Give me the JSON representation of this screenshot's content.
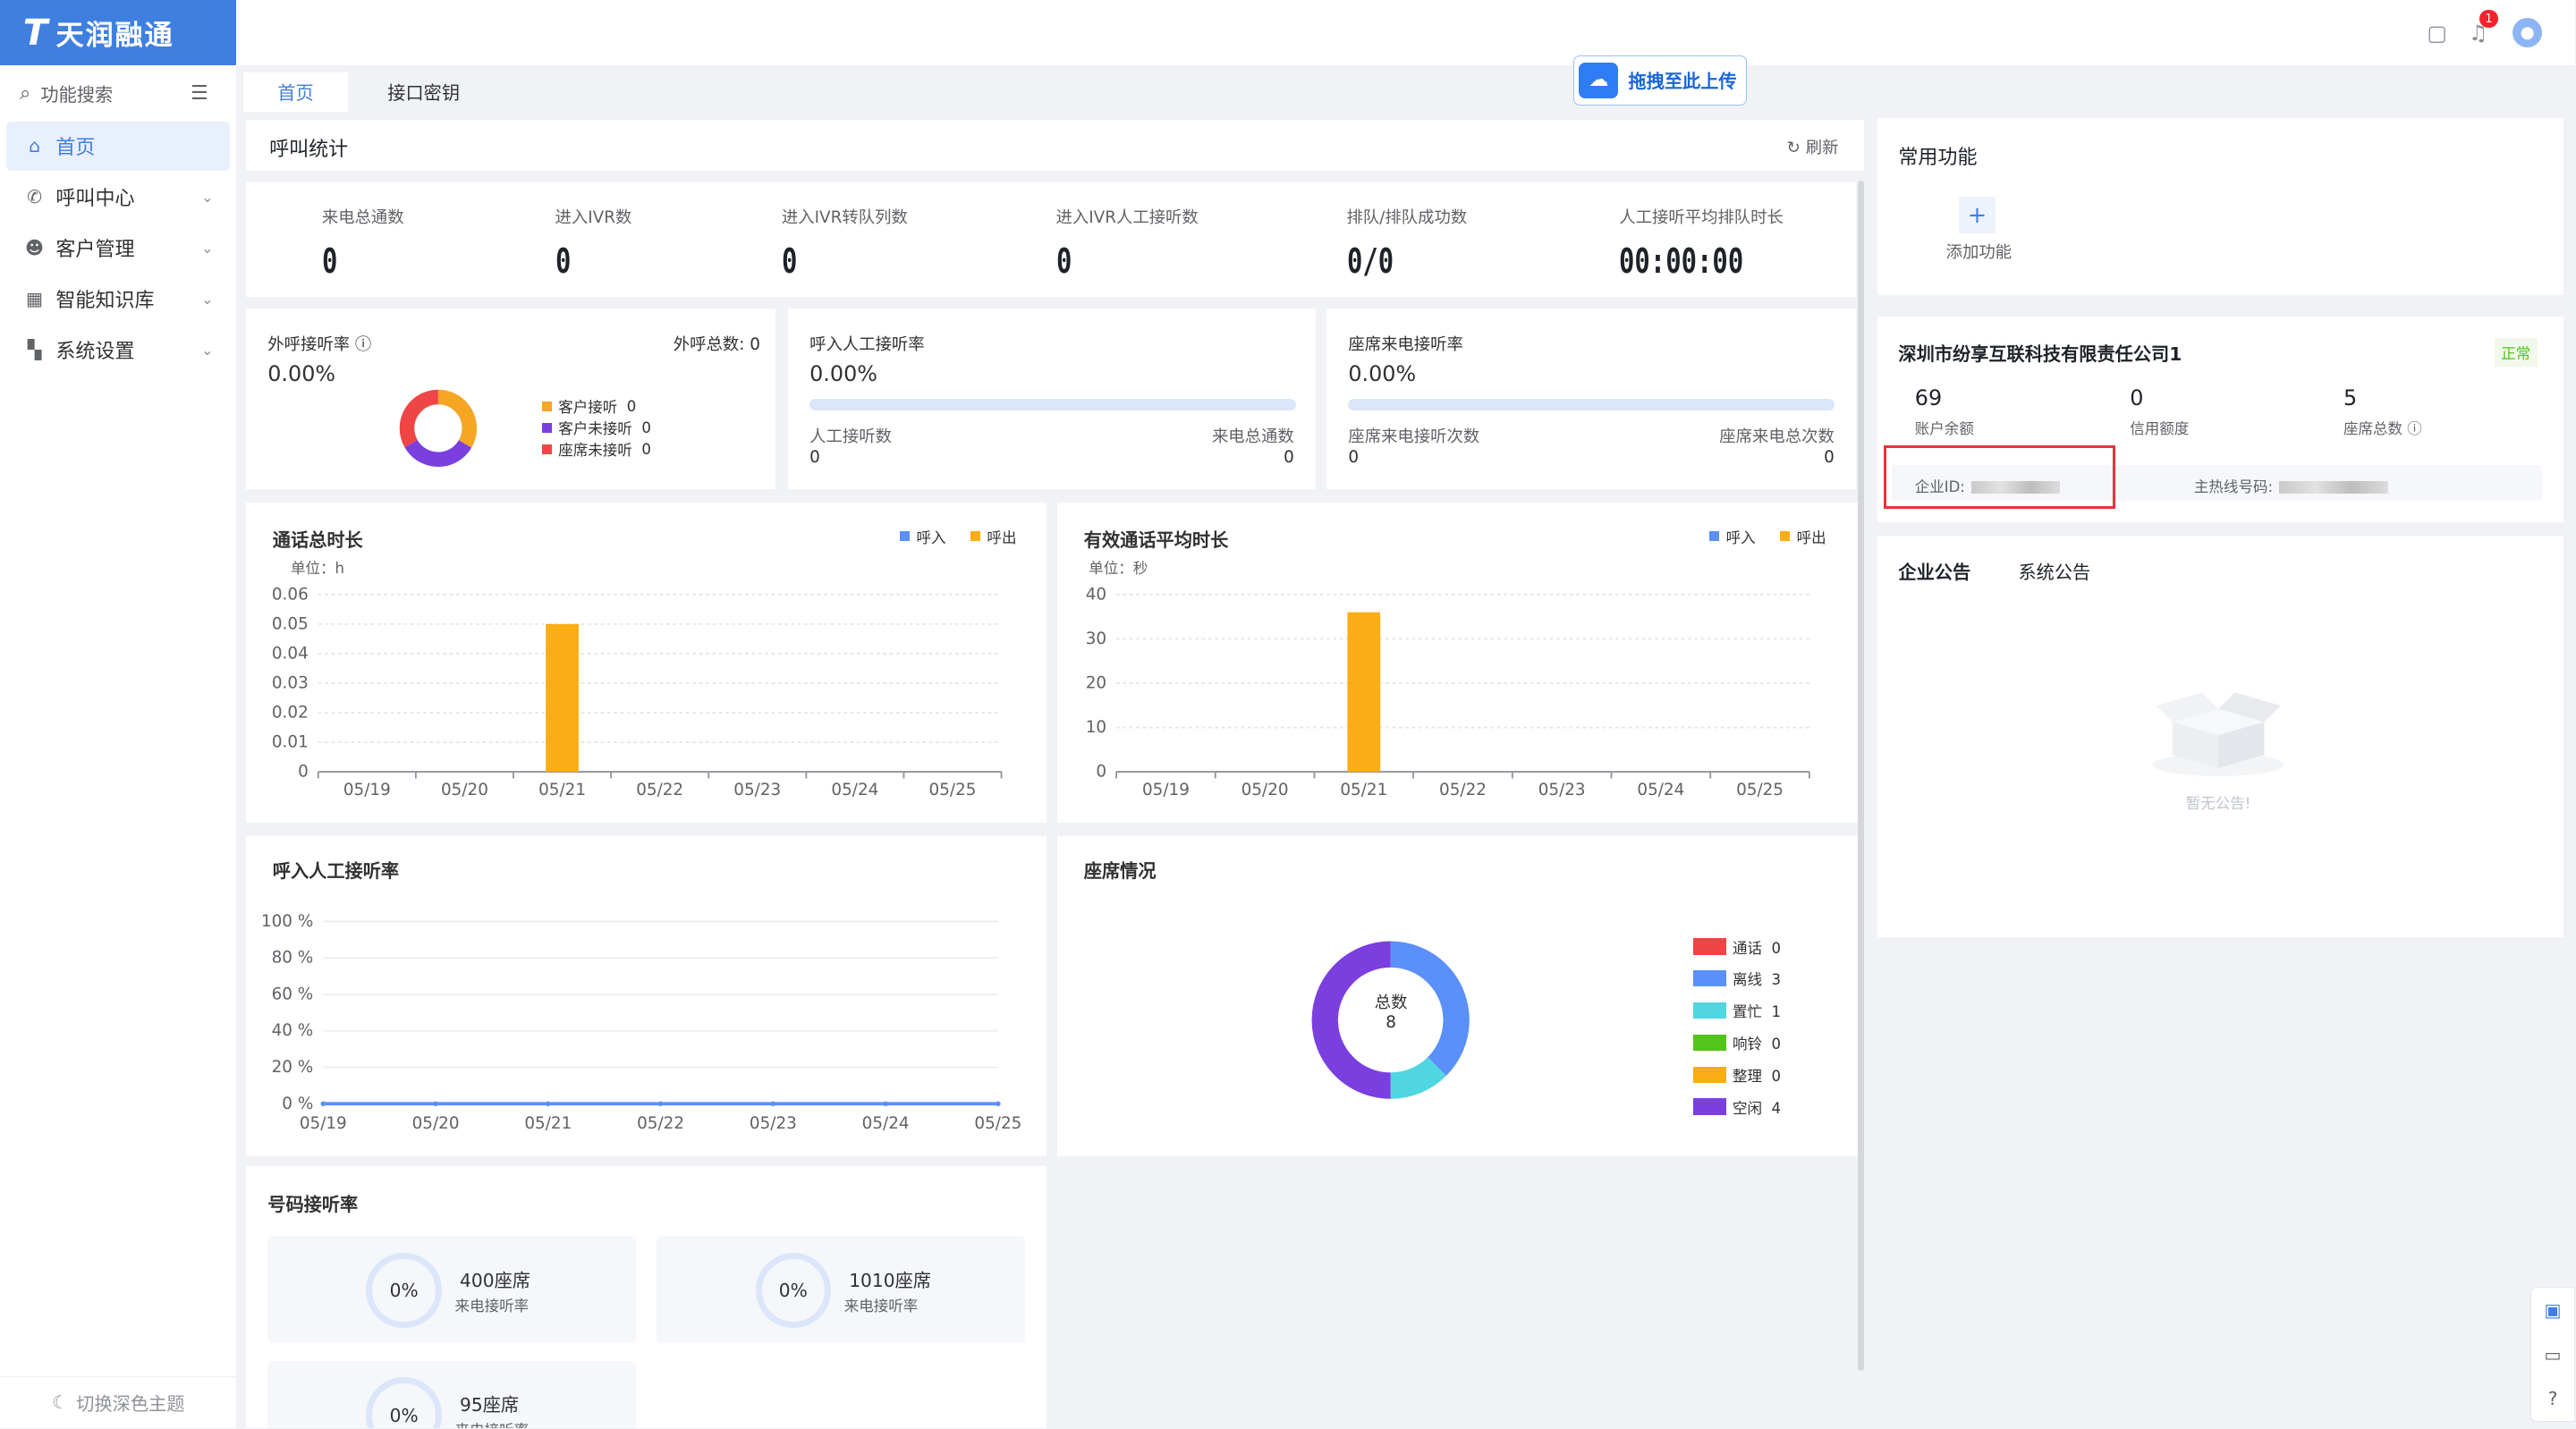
{
  "brand": {
    "logo_text": "天润融通",
    "logo_mark": "T"
  },
  "topbar": {
    "bell_count": "1",
    "calendar_icon": "calendar-icon",
    "bell_icon": "bell-icon",
    "avatar_icon": "user-avatar-icon"
  },
  "sidebar": {
    "search_label": "功能搜索",
    "items": [
      {
        "label": "首页",
        "icon": "home-icon",
        "active": true
      },
      {
        "label": "呼叫中心",
        "icon": "phone-icon"
      },
      {
        "label": "客户管理",
        "icon": "users-icon"
      },
      {
        "label": "智能知识库",
        "icon": "grid-icon"
      },
      {
        "label": "系统设置",
        "icon": "settings-grid-icon"
      }
    ],
    "theme_toggle": "切换深色主题"
  },
  "tabs": [
    {
      "label": "首页",
      "active": true
    },
    {
      "label": "接口密钥"
    }
  ],
  "upload_button": "拖拽至此上传",
  "call_stats": {
    "title": "呼叫统计",
    "refresh": "刷新",
    "items": [
      {
        "label": "来电总通数",
        "value": "0"
      },
      {
        "label": "进入IVR数",
        "value": "0"
      },
      {
        "label": "进入IVR转队列数",
        "value": "0"
      },
      {
        "label": "进入IVR人工接听数",
        "value": "0"
      },
      {
        "label": "排队/排队成功数",
        "value": "0/0"
      },
      {
        "label": "人工接听平均排队时长",
        "value": "00:00:00"
      }
    ]
  },
  "outbound": {
    "label": "外呼接听率",
    "rate": "0.00%",
    "total_label": "外呼总数:",
    "total": "0",
    "legend": [
      {
        "label": "客户接听",
        "value": "0",
        "color": "#f5a623"
      },
      {
        "label": "客户未接听",
        "value": "0",
        "color": "#7b3fe0"
      },
      {
        "label": "座席未接听",
        "value": "0",
        "color": "#f04545"
      }
    ]
  },
  "inbound_rate": {
    "label": "呼入人工接听率",
    "rate": "0.00%",
    "left_label": "人工接听数",
    "left_value": "0",
    "right_label": "来电总通数",
    "right_value": "0"
  },
  "seat_rate": {
    "label": "座席来电接听率",
    "rate": "0.00%",
    "left_label": "座席来电接听次数",
    "left_value": "0",
    "right_label": "座席来电总次数",
    "right_value": "0"
  },
  "chart_data": [
    {
      "type": "bar",
      "title": "通话总时长",
      "unit": "单位：h",
      "categories": [
        "05/19",
        "05/20",
        "05/21",
        "05/22",
        "05/23",
        "05/24",
        "05/25"
      ],
      "yticks": [
        "0",
        "0.01",
        "0.02",
        "0.03",
        "0.04",
        "0.05",
        "0.06"
      ],
      "ylim": [
        0,
        0.06
      ],
      "series": [
        {
          "name": "呼入",
          "color": "#5b8ff9",
          "values": [
            0,
            0,
            0,
            0,
            0,
            0,
            0
          ]
        },
        {
          "name": "呼出",
          "color": "#faad14",
          "values": [
            0,
            0,
            0.05,
            0,
            0,
            0,
            0
          ]
        }
      ]
    },
    {
      "type": "bar",
      "title": "有效通话平均时长",
      "unit": "单位：秒",
      "categories": [
        "05/19",
        "05/20",
        "05/21",
        "05/22",
        "05/23",
        "05/24",
        "05/25"
      ],
      "yticks": [
        "0",
        "10",
        "20",
        "30",
        "40"
      ],
      "ylim": [
        0,
        40
      ],
      "series": [
        {
          "name": "呼入",
          "color": "#5b8ff9",
          "values": [
            0,
            0,
            0,
            0,
            0,
            0,
            0
          ]
        },
        {
          "name": "呼出",
          "color": "#faad14",
          "values": [
            0,
            0,
            36,
            0,
            0,
            0,
            0
          ]
        }
      ]
    },
    {
      "type": "line",
      "title": "呼入人工接听率",
      "categories": [
        "05/19",
        "05/20",
        "05/21",
        "05/22",
        "05/23",
        "05/24",
        "05/25"
      ],
      "yticks": [
        "0 %",
        "20 %",
        "40 %",
        "60 %",
        "80 %",
        "100 %"
      ],
      "ylim": [
        0,
        100
      ],
      "series": [
        {
          "values": [
            0,
            0,
            0,
            0,
            0,
            0,
            0
          ],
          "color": "#5b8ff9"
        }
      ]
    },
    {
      "type": "pie",
      "title": "座席情况",
      "center_label": "总数",
      "total": "8",
      "slices": [
        {
          "label": "通话",
          "value": 0,
          "color": "#f04545"
        },
        {
          "label": "离线",
          "value": 3,
          "color": "#5b8ff9"
        },
        {
          "label": "置忙",
          "value": 1,
          "color": "#4fd6e0"
        },
        {
          "label": "响铃",
          "value": 0,
          "color": "#52c41a"
        },
        {
          "label": "整理",
          "value": 0,
          "color": "#faad14"
        },
        {
          "label": "空闲",
          "value": 4,
          "color": "#7b3fe0"
        }
      ]
    }
  ],
  "number_rate": {
    "title": "号码接听率",
    "items": [
      {
        "pct": "0%",
        "name": "400座席",
        "sub": "来电接听率"
      },
      {
        "pct": "0%",
        "name": "1010座席",
        "sub": "来电接听率"
      },
      {
        "pct": "0%",
        "name": "95座席",
        "sub": "来电接听率"
      }
    ]
  },
  "common": {
    "title": "常用功能",
    "add_label": "添加功能"
  },
  "company": {
    "name": "深圳市纷享互联科技有限责任公司1",
    "status": "正常",
    "balance": "69",
    "balance_label": "账户余额",
    "credit": "0",
    "credit_label": "信用额度",
    "seats": "5",
    "seats_label": "座席总数",
    "id_label": "企业ID:",
    "hotline_label": "主热线号码:"
  },
  "notice": {
    "tab1": "企业公告",
    "tab2": "系统公告",
    "empty": "暂无公告!"
  }
}
